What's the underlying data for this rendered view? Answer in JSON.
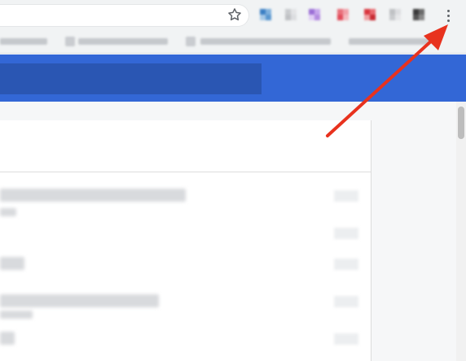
{
  "toolbar": {
    "omnibox_value": "",
    "bookmark_star_icon": "star-outline-icon",
    "menu_icon": "three-dots-vertical-icon",
    "extensions": [
      {
        "name": "extension-1",
        "colors": [
          "#3b7fc4",
          "#7fb0dc",
          "#a6c8e6",
          "#5a97d0"
        ]
      },
      {
        "name": "extension-2",
        "colors": [
          "#c9cbce",
          "#e3e4e6",
          "#bfc1c4",
          "#dcdde0"
        ]
      },
      {
        "name": "extension-3",
        "colors": [
          "#9b6fd6",
          "#c7a7ec",
          "#e0cdf5",
          "#b48ce0"
        ]
      },
      {
        "name": "extension-4",
        "colors": [
          "#e8707a",
          "#f2a0a8",
          "#e24c5a",
          "#f4b8bd"
        ]
      },
      {
        "name": "extension-5",
        "colors": [
          "#d9363e",
          "#e86a70",
          "#f0a0a3",
          "#c72a32"
        ]
      },
      {
        "name": "extension-6",
        "colors": [
          "#bfc1c4",
          "#dcdde0",
          "#c9cbce",
          "#e6e7e9"
        ]
      },
      {
        "name": "extension-7",
        "colors": [
          "#3a3a3a",
          "#6b6b6b",
          "#555555",
          "#8a8a8a"
        ]
      }
    ]
  },
  "colors": {
    "chrome_bar": "#f1f3f4",
    "app_header": "#3367d6",
    "app_search": "#2a56b3",
    "annotation_arrow": "#e8321e"
  }
}
